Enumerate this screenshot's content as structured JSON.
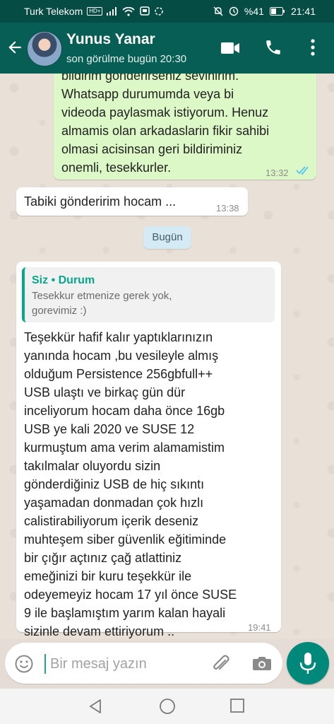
{
  "status_bar": {
    "carrier": "Turk Telekom",
    "hd_badge": "HD+",
    "battery": "%41",
    "time": "21:41"
  },
  "header": {
    "contact_name": "Yunus Yanar",
    "last_seen": "son görülme bugün 20:30",
    "icons": [
      "back-arrow-icon",
      "avatar",
      "video-call-icon",
      "phone-icon",
      "more-vert-icon"
    ]
  },
  "messages": [
    {
      "direction": "out",
      "lines": [
        "bildirim  gönderirseniz sevinirim.",
        "Whatsapp durumumda  veya bi",
        "videoda paylasmak istiyorum. Henuz",
        "almamis olan arkadaslarin fikir sahibi",
        "olmasi acisinsan geri bildiriminiz",
        "onemli,   tesekkurler."
      ],
      "time": "13:32",
      "status": "read"
    },
    {
      "direction": "in",
      "lines": [
        "Tabiki gönderirim hocam ..."
      ],
      "time": "13:38"
    },
    {
      "date_separator": "Bugün"
    },
    {
      "direction": "in",
      "quote": {
        "title": "Siz • Durum",
        "lines": [
          "Tesekkur etmenize gerek yok,",
          "gorevimiz :)"
        ]
      },
      "lines": [
        "Teşekkür hafif kalır  yaptıklarınızın",
        "yanında hocam ,bu vesileyle almış",
        "olduğum Persistence 256gbfull++",
        "USB   ulaştı ve birkaç gün dür",
        "inceliyorum  hocam daha önce 16gb",
        "USB ye kali 2020  ve SUSE 12",
        "kurmuştum ama verim alamamistim",
        "takılmalar oluyordu sizin",
        "gönderdiğiniz USB de hiç sıkıntı",
        "yaşamadan donmadan   çok hızlı",
        "calistirabiliyorum içerik deseniz",
        "muhteşem siber güvenlik eğitiminde",
        "bir çığır açtınız çağ atlattiniz",
        "emeğinizi bir kuru teşekkür ile",
        "odeyemeyiz hocam 17 yıl önce SUSE",
        "9 ile başlamıştım yarım kalan hayali",
        "sizinle devam ettiriyorum .."
      ],
      "time": "19:41"
    }
  ],
  "composer": {
    "placeholder": "Bir mesaj yazın"
  },
  "colors": {
    "header": "#075e54",
    "outgoing_bubble": "#dcf8c6",
    "incoming_bubble": "#ffffff",
    "accent": "#06a88b",
    "mic_button": "#00897b",
    "read_ticks": "#4fc3f7"
  }
}
